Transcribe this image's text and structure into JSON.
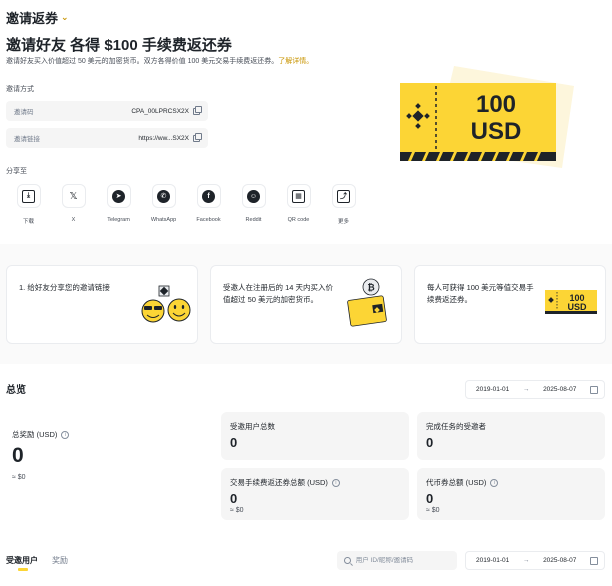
{
  "header": {
    "title": "邀请返券"
  },
  "hero": {
    "title": "邀请好友 各得 $100 手续费返还券",
    "subtitle": "邀请好友买入价值超过 50 美元的加密货币。双方各得价值 100 美元交易手续费返还券。",
    "link": "了解详情。"
  },
  "invite": {
    "section_label": "邀请方式",
    "code_key": "邀请码",
    "code_value": "CPA_00LPRCSX2X",
    "link_key": "邀请链接",
    "link_value": "https://ww...SX2X"
  },
  "share": {
    "label": "分享至",
    "items": [
      {
        "label": "下载",
        "icon": "download-icon",
        "glyph": "⤓"
      },
      {
        "label": "X",
        "icon": "x-icon",
        "glyph": "𝕏"
      },
      {
        "label": "Telegram",
        "icon": "telegram-icon",
        "glyph": "➤"
      },
      {
        "label": "WhatsApp",
        "icon": "whatsapp-icon",
        "glyph": "✆"
      },
      {
        "label": "Facebook",
        "icon": "facebook-icon",
        "glyph": "f"
      },
      {
        "label": "Reddit",
        "icon": "reddit-icon",
        "glyph": "☺"
      },
      {
        "label": "QR code",
        "icon": "qr-code-icon",
        "glyph": "▦"
      },
      {
        "label": "更多",
        "icon": "more-icon",
        "glyph": "⤴"
      }
    ]
  },
  "voucher": {
    "amount": "100",
    "currency": "USD"
  },
  "steps": [
    {
      "text": "1. 给好友分享您的邀请链接"
    },
    {
      "text": "受邀人在注册后的 14 天内买入价值超过 50 美元的加密货币。"
    },
    {
      "text": "每人可获得 100 美元等值交易手续费返还券。"
    }
  ],
  "overview": {
    "title": "总览",
    "date_start": "2019-01-01",
    "date_end": "2025-08-07",
    "date_arrow": "→",
    "total_label": "总奖励 (USD)",
    "total_value": "0",
    "total_sub": "≈ $0",
    "cards": {
      "invited_users": {
        "label": "受邀用户总数",
        "value": "0"
      },
      "completed": {
        "label": "完成任务的受邀者",
        "value": "0"
      },
      "fee_voucher": {
        "label": "交易手续费返还券总额 (USD)",
        "value": "0",
        "sub": "≈ $0"
      },
      "token_voucher": {
        "label": "代币券总额 (USD)",
        "value": "0",
        "sub": "≈ $0"
      }
    }
  },
  "bottom": {
    "tab_invited": "受邀用户",
    "tab_rewards": "奖励",
    "search_placeholder": "用户 ID/昵称/邀请码",
    "date_start": "2019-01-01",
    "date_end": "2025-08-07",
    "date_arrow": "→"
  },
  "colors": {
    "brand_yellow": "#FCD535",
    "accent_gold": "#C99400",
    "text": "#1E2329"
  }
}
